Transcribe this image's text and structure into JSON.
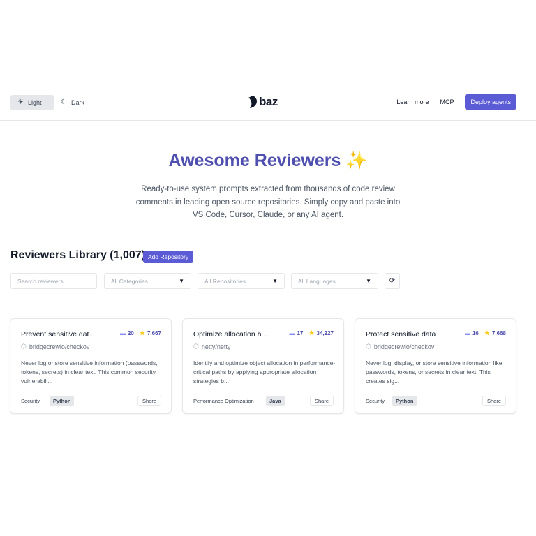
{
  "header": {
    "theme": {
      "light_label": "Light",
      "dark_label": "Dark",
      "selected": "Light"
    },
    "logo_text": "baz",
    "nav": {
      "learn_more": "Learn more",
      "mcp": "MCP",
      "deploy": "Deploy agents"
    }
  },
  "hero": {
    "title": "Awesome Reviewers ✨",
    "description": "Ready-to-use system prompts extracted from thousands of code review comments in leading open source repositories. Simply copy and paste into VS Code, Cursor, Claude, or any AI agent."
  },
  "library": {
    "title": "Reviewers Library (1,007)",
    "add_repo_label": "Add Repository",
    "search_placeholder": "Search reviewers...",
    "filters": {
      "categories": "All Categories",
      "repositories": "All Repositories",
      "languages": "All Languages"
    },
    "refresh_icon": "⟳"
  },
  "cards": [
    {
      "title": "Prevent sensitive dat...",
      "comments": "20",
      "stars": "7,667",
      "repo": "bridgecrewio/checkov",
      "description": "Never log or store sensitive information (passwords, tokens, secrets) in clear text. This common security vulnerabili...",
      "category": "Security",
      "language": "Python",
      "share_label": "Share"
    },
    {
      "title": "Optimize allocation h...",
      "comments": "17",
      "stars": "34,227",
      "repo": "netty/netty",
      "description": "Identify and optimize object allocation in performance-critical paths by applying appropriate allocation strategies b...",
      "category": "Performance Optimization",
      "language": "Java",
      "share_label": "Share"
    },
    {
      "title": "Protect sensitive data",
      "comments": "16",
      "stars": "7,668",
      "repo": "bridgecrewio/checkov",
      "description": "Never log, display, or store sensitive information like passwords, tokens, or secrets in clear text. This creates sig...",
      "category": "Security",
      "language": "Python",
      "share_label": "Share"
    }
  ],
  "colors": {
    "accent": "#5b5bd6",
    "title": "#4f4fb0"
  }
}
